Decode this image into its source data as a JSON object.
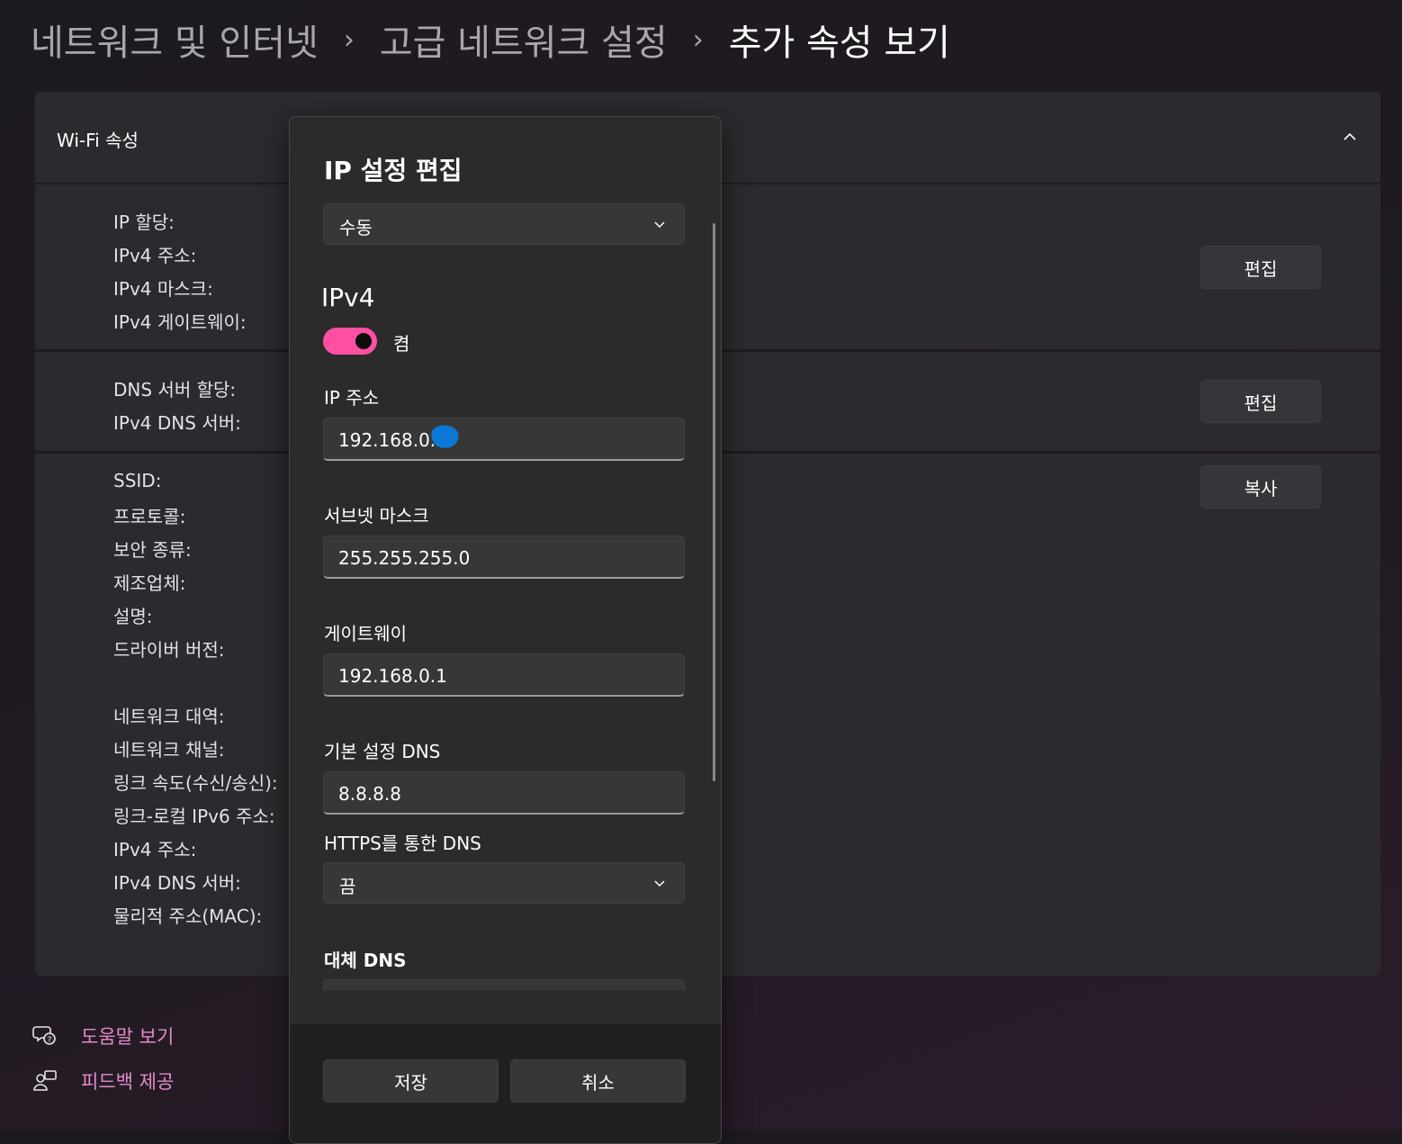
{
  "breadcrumb": {
    "item1": "네트워크 및 인터넷",
    "item2": "고급 네트워크 설정",
    "current": "추가 속성 보기",
    "separator": "›"
  },
  "wifi": {
    "header": "Wi-Fi 속성",
    "ip_labels": [
      "IP 할당:",
      "IPv4 주소:",
      "IPv4 마스크:",
      "IPv4 게이트웨이:"
    ],
    "dns_labels": [
      "DNS 서버 할당:",
      "IPv4 DNS 서버:"
    ],
    "info_labels": [
      "SSID:",
      "프로토콜:",
      "보안 종류:",
      "제조업체:",
      "설명:",
      "드라이버 버전:"
    ],
    "info_labels2": [
      "네트워크 대역:",
      "네트워크 채널:",
      "링크 속도(수신/송신):",
      "링크-로컬 IPv6 주소:",
      "IPv4 주소:",
      "IPv4 DNS 서버:",
      "물리적 주소(MAC):"
    ],
    "edit_ip_label": "편집",
    "edit_dns_label": "편집",
    "copy_label": "복사"
  },
  "links": {
    "help": "도움말 보기",
    "feedback": "피드백 제공"
  },
  "dialog": {
    "title": "IP 설정 편집",
    "mode_value": "수동",
    "ipv4_heading": "IPv4",
    "toggle_label": "켬",
    "toggle_on": true,
    "ip_label": "IP 주소",
    "ip_value": "192.168.0.1",
    "subnet_label": "서브넷 마스크",
    "subnet_value": "255.255.255.0",
    "gateway_label": "게이트웨이",
    "gateway_value": "192.168.0.1",
    "dns_label": "기본 설정 DNS",
    "dns_value": "8.8.8.8",
    "https_label": "HTTPS를 통한 DNS",
    "https_value": "끔",
    "alt_dns_label": "대체 DNS",
    "save_label": "저장",
    "cancel_label": "취소"
  },
  "colors": {
    "accent_toggle": "#ff4fa3",
    "link": "#e38cc8",
    "redaction": "#0a78d4"
  }
}
